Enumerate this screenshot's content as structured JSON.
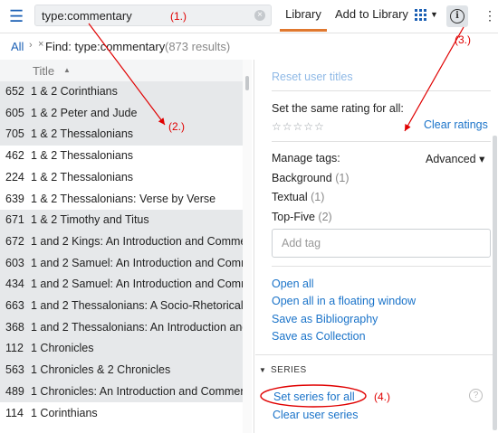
{
  "toolbar": {
    "search_value": "type:commentary",
    "tab_library": "Library",
    "tab_add": "Add to Library",
    "menu_icon": "hamburger-icon",
    "info_icon": "info-icon",
    "more_icon": "kebab-icon",
    "accent": "#e0782f"
  },
  "breadcrumb": {
    "all": "All",
    "sep": "›",
    "close": "×",
    "find": "Find: type:commentary",
    "count": "(873 results)"
  },
  "list": {
    "header": "Title",
    "rows": [
      {
        "num": "652",
        "title": "1 & 2 Corinthians"
      },
      {
        "num": "605",
        "title": "1 & 2 Peter and Jude"
      },
      {
        "num": "705",
        "title": "1 & 2 Thessalonians"
      },
      {
        "num": "462",
        "title": "1 & 2 Thessalonians"
      },
      {
        "num": "224",
        "title": "1 & 2 Thessalonians"
      },
      {
        "num": "639",
        "title": "1 & 2 Thessalonians: Verse by Verse"
      },
      {
        "num": "671",
        "title": "1 & 2 Timothy and Titus"
      },
      {
        "num": "672",
        "title": "1 and 2 Kings: An Introduction and Commen"
      },
      {
        "num": "603",
        "title": "1 and 2 Samuel: An Introduction and Comm"
      },
      {
        "num": "434",
        "title": "1 and 2 Samuel: An Introduction and Comm"
      },
      {
        "num": "663",
        "title": "1 and 2 Thessalonians: A Socio-Rhetorical C"
      },
      {
        "num": "368",
        "title": "1 and 2 Thessalonians: An Introduction and"
      },
      {
        "num": "112",
        "title": "1 Chronicles"
      },
      {
        "num": "563",
        "title": "1 Chronicles & 2 Chronicles"
      },
      {
        "num": "489",
        "title": "1 Chronicles: An Introduction and Comment"
      },
      {
        "num": "114",
        "title": "1 Corinthians"
      }
    ]
  },
  "info": {
    "reset_titles": "Reset user titles",
    "rating_label": "Set the same rating for all:",
    "stars": "☆☆☆☆☆",
    "clear_ratings": "Clear ratings",
    "manage_tags": "Manage tags:",
    "advanced": "Advanced ▾",
    "tags": [
      {
        "name": "Background",
        "count": "(1)"
      },
      {
        "name": "Textual",
        "count": "(1)"
      },
      {
        "name": "Top-Five",
        "count": "(2)"
      }
    ],
    "add_tag_placeholder": "Add tag",
    "open_all": "Open all",
    "open_floating": "Open all in a floating window",
    "save_biblio": "Save as Bibliography",
    "save_collection": "Save as Collection",
    "series_header": "SERIES",
    "set_series": "Set series for all",
    "clear_series": "Clear user series",
    "help": "?"
  },
  "annotations": [
    "(1.)",
    "(2.)",
    "(3.)",
    "(4.)"
  ],
  "colors": {
    "annotation": "#e00000",
    "link": "#1a73c9"
  }
}
